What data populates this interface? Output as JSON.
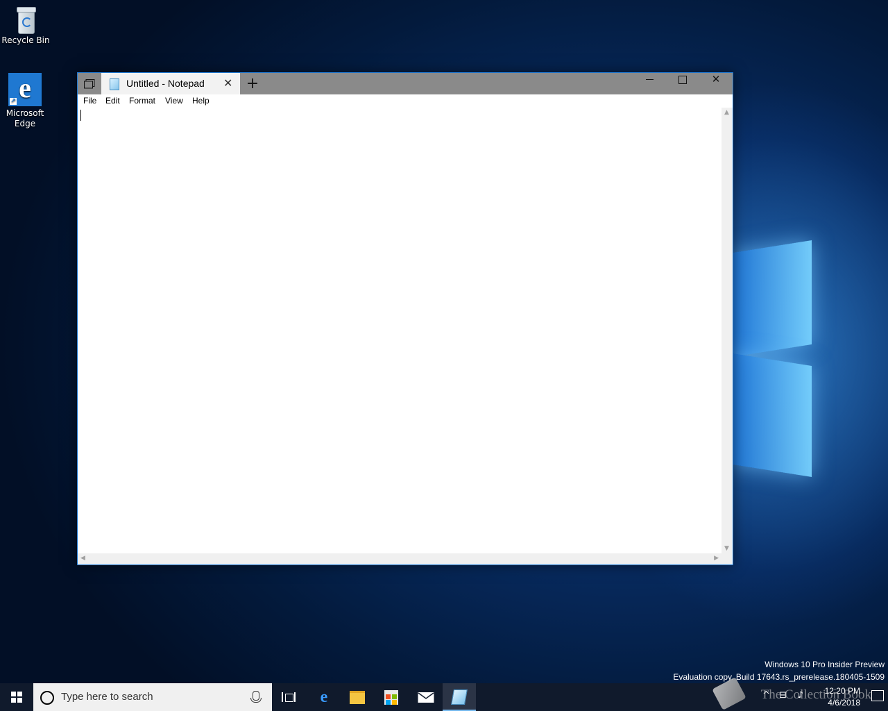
{
  "desktop": {
    "icons": [
      {
        "label": "Recycle Bin",
        "icon": "recycle-bin-icon"
      },
      {
        "label": "Microsoft Edge",
        "icon": "edge-icon"
      }
    ],
    "watermark": {
      "line1": "Windows 10 Pro Insider Preview",
      "line2": "Evaluation copy. Build 17643.rs_prerelease.180405-1509"
    },
    "overlay_text": "The Collection Book"
  },
  "notepad": {
    "tab_title": "Untitled - Notepad",
    "new_tab_glyph": "+",
    "close_tab_glyph": "✕",
    "close_glyph": "✕",
    "menu": [
      "File",
      "Edit",
      "Format",
      "View",
      "Help"
    ],
    "content": "",
    "accent": "#1f78d1"
  },
  "taskbar": {
    "search_placeholder": "Type here to search",
    "pinned": [
      "task-view-icon",
      "edge-icon",
      "file-explorer-icon",
      "store-icon",
      "mail-icon",
      "notepad-icon"
    ],
    "clock": {
      "time": "12:20 PM",
      "date": "4/6/2018"
    },
    "background": "#101a2c"
  }
}
